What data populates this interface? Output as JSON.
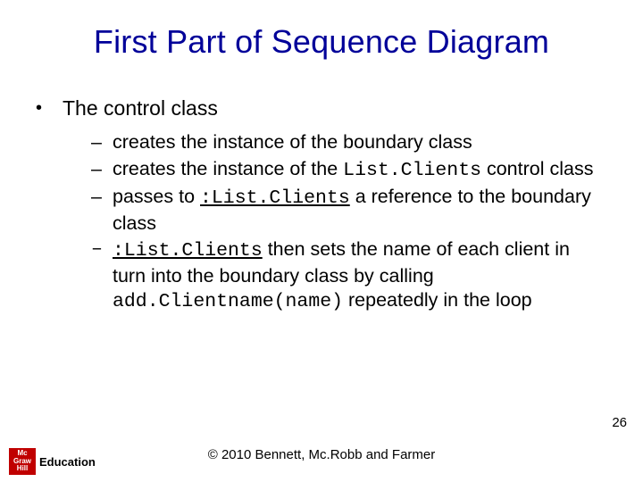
{
  "title": "First Part of Sequence Diagram",
  "topBullet": "The control class",
  "subs": {
    "s1": "creates the instance of the boundary class",
    "s2a": "creates the instance of the ",
    "s2code": "List.Clients",
    "s2b": " control class",
    "s3a": "passes to ",
    "s3code": ":List.Clients",
    "s3b": " a reference to the boundary class",
    "s4code1": ":List.Clients",
    "s4a": " then sets the name of each client in turn into the boundary class by calling ",
    "s4code2": "add.Clientname(name)",
    "s4b": " repeatedly in the loop"
  },
  "pageNumber": "26",
  "copyright": "© 2010 Bennett, Mc.Robb and Farmer",
  "logo": {
    "line1": "Mc",
    "line2": "Graw",
    "line3": "Hill",
    "word": "Education"
  }
}
